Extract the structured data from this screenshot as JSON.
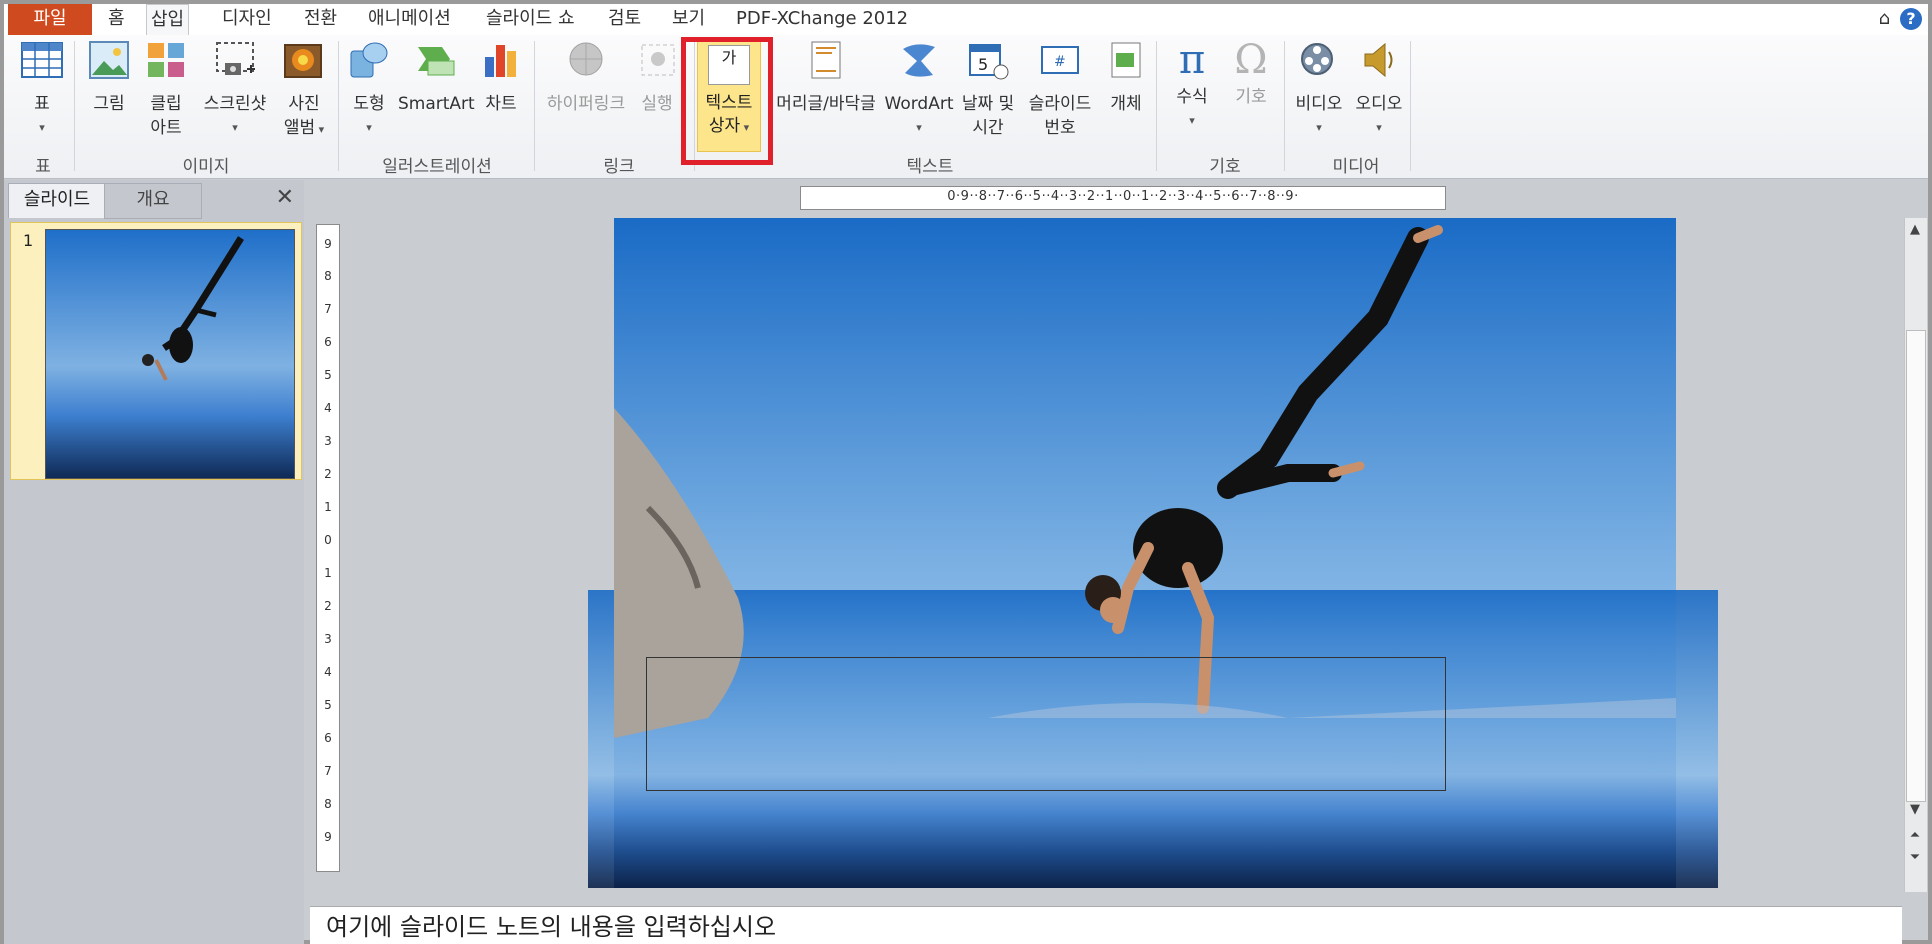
{
  "menu": {
    "file": "파일",
    "tabs": [
      "홈",
      "삽입",
      "디자인",
      "전환",
      "애니메이션",
      "슬라이드 쇼",
      "검토",
      "보기",
      "PDF-XChange 2012"
    ],
    "active_tab": "삽입"
  },
  "ribbon": {
    "table": "표",
    "picture": "그림",
    "clipart_1": "클립",
    "clipart_2": "아트",
    "screenshot": "스크린샷",
    "album_1": "사진",
    "album_2": "앨범",
    "shape": "도형",
    "smartart": "SmartArt",
    "chart": "차트",
    "hyperlink": "하이퍼링크",
    "action": "실행",
    "textbox_icon": "가",
    "textbox_1": "텍스트",
    "textbox_2": "상자",
    "header_footer": "머리글/바닥글",
    "wordart": "WordArt",
    "datetime_1": "날짜 및",
    "datetime_2": "시간",
    "slidenum_1": "슬라이드",
    "slidenum_2": "번호",
    "object": "개체",
    "equation": "수식",
    "symbol": "기호",
    "video": "비디오",
    "audio": "오디오",
    "groups": {
      "table": "표",
      "images": "이미지",
      "illustrations": "일러스트레이션",
      "links": "링크",
      "text": "텍스트",
      "symbols": "기호",
      "media": "미디어"
    }
  },
  "panel": {
    "tab_slides": "슬라이드",
    "tab_outline": "개요",
    "slide_number": "1"
  },
  "ruler": {
    "horizontal": "0·9··8··7··6··5··4··3··2··1··0··1··2··3··4··5··6··7··8··9·",
    "vertical": [
      "9",
      "8",
      "7",
      "6",
      "5",
      "4",
      "3",
      "2",
      "1",
      "0",
      "1",
      "2",
      "3",
      "4",
      "5",
      "6",
      "7",
      "8",
      "9"
    ]
  },
  "notes": {
    "placeholder": "여기에 슬라이드 노트의 내용을 입력하십시오"
  },
  "colors": {
    "file_tab": "#d04a1f",
    "highlight": "#e0202a",
    "textbox_selected": "#fde58b"
  }
}
